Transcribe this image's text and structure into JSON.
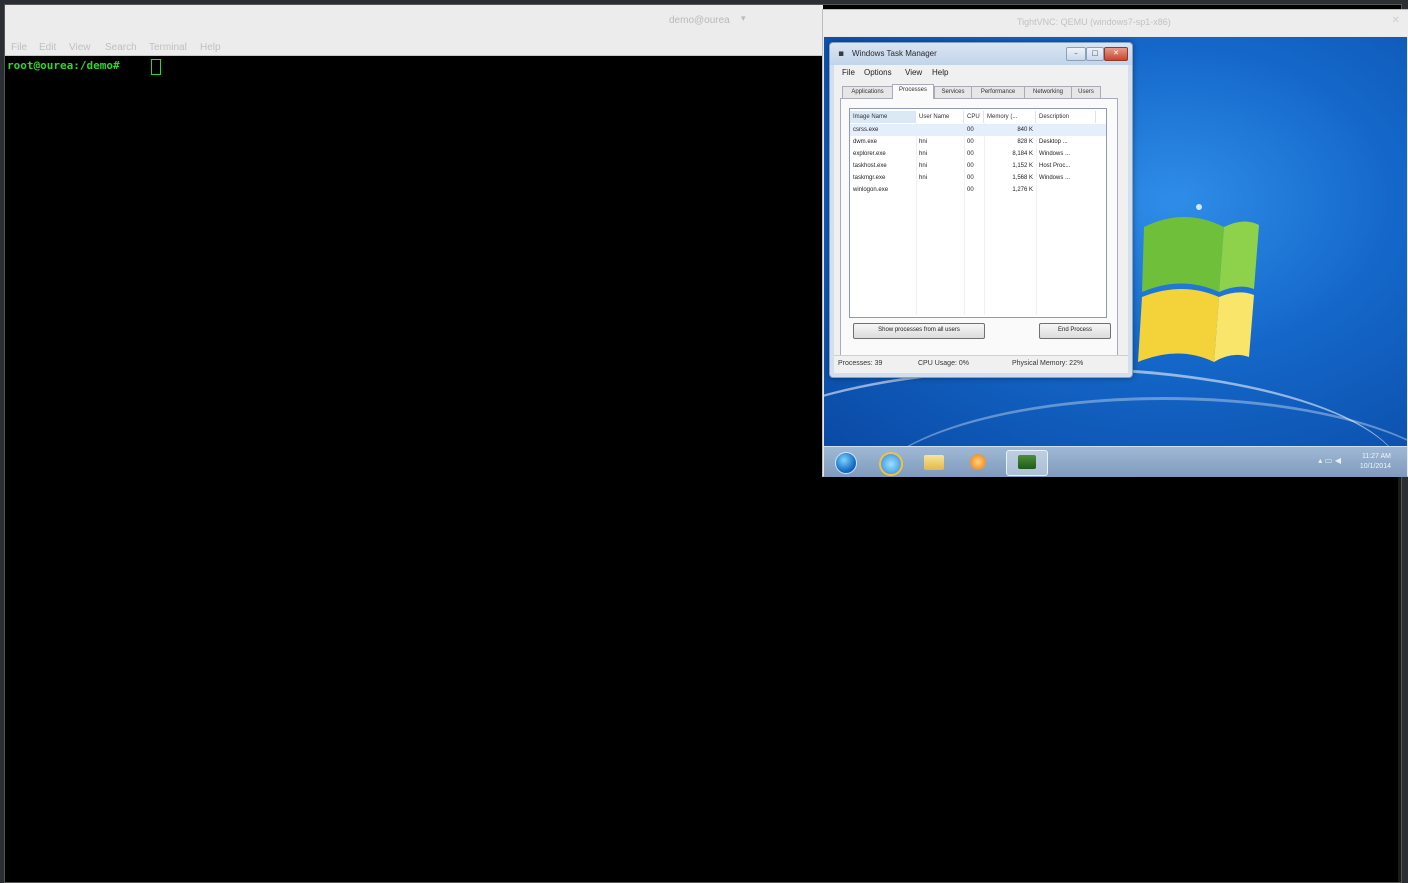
{
  "terminal": {
    "title": "demo@ourea",
    "title_arrow": "▾",
    "menu": [
      "File",
      "Edit",
      "View",
      "Search",
      "Terminal",
      "Help"
    ],
    "prompt": "root@ourea:/demo#"
  },
  "vnc": {
    "title": "TightVNC: QEMU (windows7-sp1-x86)",
    "close_glyph": "✕"
  },
  "task_manager": {
    "title": "Windows Task Manager",
    "window_buttons": {
      "minimize": "–",
      "maximize": "□",
      "close": "✕"
    },
    "menu": [
      "File",
      "Options",
      "View",
      "Help"
    ],
    "tabs": [
      "Applications",
      "Processes",
      "Services",
      "Performance",
      "Networking",
      "Users"
    ],
    "active_tab": "Processes",
    "columns": [
      "Image Name",
      "User Name",
      "CPU",
      "Memory (...",
      "Description"
    ],
    "rows": [
      {
        "image": "csrss.exe",
        "user": "",
        "cpu": "00",
        "memory": "840 K",
        "description": ""
      },
      {
        "image": "dwm.exe",
        "user": "hni",
        "cpu": "00",
        "memory": "828 K",
        "description": "Desktop ..."
      },
      {
        "image": "explorer.exe",
        "user": "hni",
        "cpu": "00",
        "memory": "8,184 K",
        "description": "Windows ..."
      },
      {
        "image": "taskhost.exe",
        "user": "hni",
        "cpu": "00",
        "memory": "1,152 K",
        "description": "Host Proc..."
      },
      {
        "image": "taskmgr.exe",
        "user": "hni",
        "cpu": "00",
        "memory": "1,568 K",
        "description": "Windows ..."
      },
      {
        "image": "winlogon.exe",
        "user": "",
        "cpu": "00",
        "memory": "1,276 K",
        "description": ""
      }
    ],
    "show_all_button": "Show processes from all users",
    "end_process_button": "End Process",
    "status": {
      "processes": "Processes: 39",
      "cpu": "CPU Usage: 0%",
      "memory": "Physical Memory: 22%"
    }
  },
  "taskbar": {
    "clock_time": "11:27 AM",
    "clock_date": "10/1/2014",
    "tray_glyphs": "▴  ▭  ◀"
  },
  "colors": {
    "terminal_prompt": "#2fd42f",
    "desktop_blue": "#1467c9",
    "taskbar": "#8fa9c8"
  }
}
